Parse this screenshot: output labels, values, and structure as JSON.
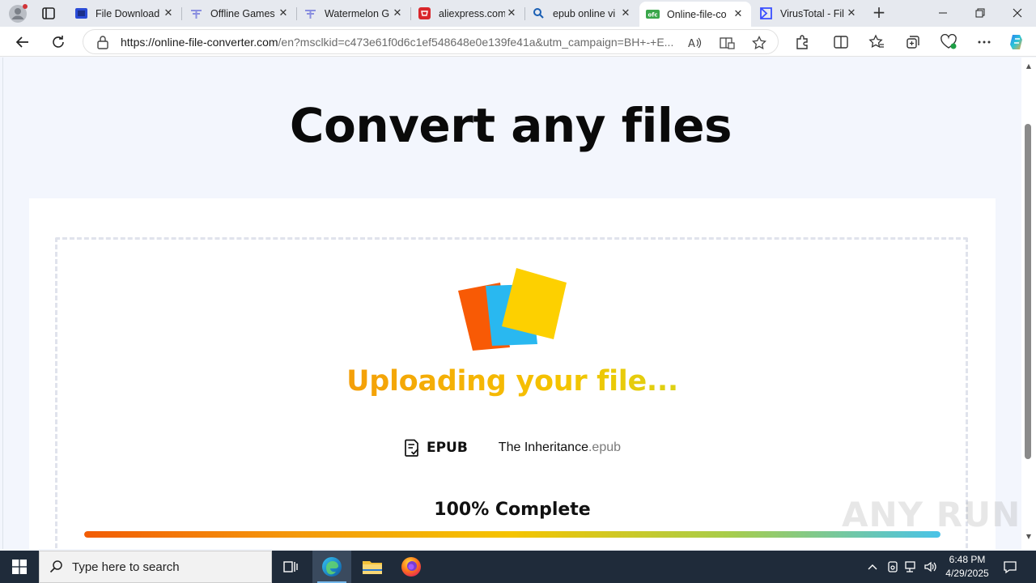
{
  "browser": {
    "tabs": [
      {
        "title": "File Download",
        "icon": "file-download-icon",
        "active": false
      },
      {
        "title": "Offline Games",
        "icon": "offline-games-icon",
        "active": false
      },
      {
        "title": "Watermelon G",
        "icon": "watermelon-icon",
        "active": false
      },
      {
        "title": "aliexpress.com",
        "icon": "aliexpress-icon",
        "active": false
      },
      {
        "title": "epub online vi",
        "icon": "search-icon",
        "active": false
      },
      {
        "title": "Online-file-co",
        "icon": "ofc-icon",
        "active": true
      },
      {
        "title": "VirusTotal - Fil",
        "icon": "virustotal-icon",
        "active": false
      }
    ],
    "new_tab_symbol": "+",
    "address": {
      "host": "https://online-file-converter.com",
      "path": "/en?msclkid=c473e61f0d6c1ef548648e0e139fe41a&utm_campaign=BH+-+E..."
    }
  },
  "page": {
    "headline": "Convert any files",
    "status_title": "Uploading your file...",
    "file": {
      "format": "EPUB",
      "name": "The Inheritance",
      "extension": ".epub"
    },
    "progress": {
      "label": "100% Complete",
      "percent": 100
    },
    "watermark": "ANY RUN"
  },
  "taskbar": {
    "search_placeholder": "Type here to search",
    "time": "6:48 PM",
    "date": "4/29/2025"
  },
  "colors": {
    "accent_orange": "#f25c05",
    "accent_yellow": "#f5c400",
    "accent_blue": "#49c3e8",
    "taskbar": "#1f2b3a"
  }
}
